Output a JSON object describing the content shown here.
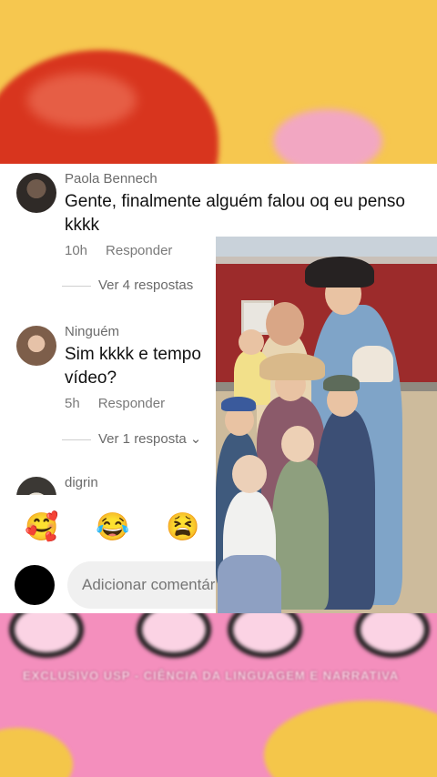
{
  "comments": [
    {
      "username": "Paola Bennech",
      "text": "Gente, finalmente alguém falou oq eu penso kkkk",
      "time": "10h",
      "reply": "Responder",
      "view_replies": "Ver 4 respostas"
    },
    {
      "username": "Ninguém",
      "text": "Sim kkkk e tempo vídeo?",
      "time": "5h",
      "reply": "Responder",
      "view_replies": "Ver 1 resposta"
    },
    {
      "username": "digrin"
    }
  ],
  "emojis": [
    {
      "icon": "smiling-face-with-hearts-icon",
      "glyph": "🥰"
    },
    {
      "icon": "face-with-tears-of-joy-icon",
      "glyph": "😂"
    },
    {
      "icon": "tired-face-icon",
      "glyph": "😫"
    }
  ],
  "composer": {
    "placeholder": "Adicionar comentário..."
  },
  "background": {
    "caption": "EXCLUSIVO USP - CIÊNCIA DA LINGUAGEM E NARRATIVA",
    "colors": {
      "top": "#f6c74f",
      "bottom": "#f48fbd",
      "heart": "#d8351e"
    }
  },
  "colors": {
    "panel": "#ffffff",
    "text": "#111111",
    "muted": "#7a7a7a",
    "input": "#f0f0f0"
  }
}
